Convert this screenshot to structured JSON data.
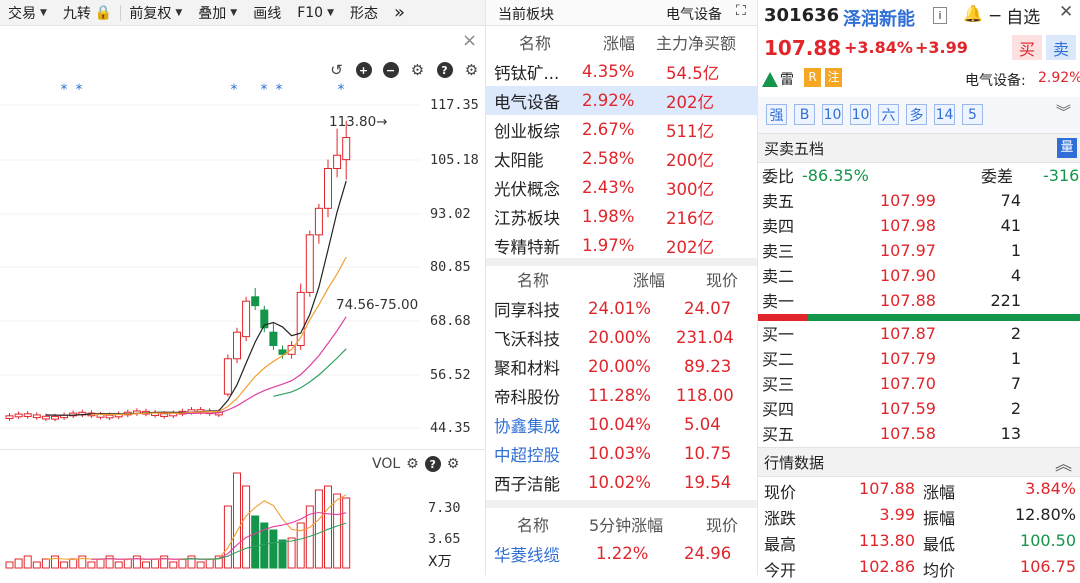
{
  "toolbar": {
    "items": [
      "交易",
      "九转",
      "前复权",
      "叠加",
      "画线",
      "F10",
      "形态"
    ],
    "more": "»",
    "close": "×"
  },
  "chart": {
    "y_labels": [
      "117.35",
      "105.18",
      "93.02",
      "80.85",
      "68.68",
      "56.52",
      "44.35"
    ],
    "high_label": "113.80→",
    "ma_label": "74.56-75.00",
    "vol_label": "VOL",
    "vol_y": [
      "7.30",
      "3.65"
    ],
    "vol_unit": "X万",
    "star": "*"
  },
  "middle": {
    "top": {
      "left": "当前板块",
      "right": "电气设备"
    },
    "sector_headers": [
      "名称",
      "涨幅",
      "主力净买额"
    ],
    "sectors": [
      {
        "name": "钙钛矿...",
        "pct": "4.35%",
        "amt": "54.5亿"
      },
      {
        "name": "电气设备",
        "pct": "2.92%",
        "amt": "202亿"
      },
      {
        "name": "创业板综",
        "pct": "2.67%",
        "amt": "511亿"
      },
      {
        "name": "太阳能",
        "pct": "2.58%",
        "amt": "200亿"
      },
      {
        "name": "光伏概念",
        "pct": "2.43%",
        "amt": "300亿"
      },
      {
        "name": "江苏板块",
        "pct": "1.98%",
        "amt": "216亿"
      },
      {
        "name": "专精特新",
        "pct": "1.97%",
        "amt": "202亿"
      }
    ],
    "stock_headers": [
      "名称",
      "涨幅",
      "现价"
    ],
    "stocks": [
      {
        "name": "同享科技",
        "pct": "24.01%",
        "price": "24.07"
      },
      {
        "name": "飞沃科技",
        "pct": "20.00%",
        "price": "231.04"
      },
      {
        "name": "聚和材料",
        "pct": "20.00%",
        "price": "89.23"
      },
      {
        "name": "帝科股份",
        "pct": "11.28%",
        "price": "118.00"
      },
      {
        "name": "协鑫集成",
        "pct": "10.04%",
        "price": "5.04"
      },
      {
        "name": "中超控股",
        "pct": "10.03%",
        "price": "10.75"
      },
      {
        "name": "西子洁能",
        "pct": "10.02%",
        "price": "19.54"
      }
    ],
    "min5_headers": [
      "名称",
      "5分钟涨幅",
      "现价"
    ],
    "min5": [
      {
        "name": "华菱线缆",
        "pct": "1.22%",
        "price": "24.96"
      }
    ]
  },
  "right": {
    "code": "301636",
    "name": "泽润新能",
    "info_tag": "i",
    "self_select": "自选",
    "price": "107.88",
    "pct": "+3.84%",
    "chg": "+3.99",
    "buy": "买",
    "sell": "卖",
    "lei": "雷",
    "R": "R",
    "zhu": "注",
    "sector_label": "电气设备:",
    "sector_pct": "2.92%",
    "tags": [
      "强",
      "B",
      "10",
      "10",
      "六",
      "多",
      "14",
      "5"
    ],
    "ob_title": "买卖五档",
    "ob_badge": "量",
    "weibi_label": "委比",
    "weibi": "-86.35%",
    "weicha_label": "委差",
    "weicha": "-316",
    "asks": [
      {
        "label": "卖五",
        "price": "107.99",
        "vol": "74"
      },
      {
        "label": "卖四",
        "price": "107.98",
        "vol": "41"
      },
      {
        "label": "卖三",
        "price": "107.97",
        "vol": "1"
      },
      {
        "label": "卖二",
        "price": "107.90",
        "vol": "4"
      },
      {
        "label": "卖一",
        "price": "107.88",
        "vol": "221"
      }
    ],
    "bids": [
      {
        "label": "买一",
        "price": "107.87",
        "vol": "2"
      },
      {
        "label": "买二",
        "price": "107.79",
        "vol": "1"
      },
      {
        "label": "买三",
        "price": "107.70",
        "vol": "7"
      },
      {
        "label": "买四",
        "price": "107.59",
        "vol": "2"
      },
      {
        "label": "买五",
        "price": "107.58",
        "vol": "13"
      }
    ],
    "quote_title": "行情数据",
    "quotes": [
      {
        "l1": "现价",
        "v1": "107.88",
        "l2": "涨幅",
        "v2": "3.84%"
      },
      {
        "l1": "涨跌",
        "v1": "3.99",
        "l2": "振幅",
        "v2": "12.80%"
      },
      {
        "l1": "最高",
        "v1": "113.80",
        "l2": "最低",
        "v2": "100.50"
      },
      {
        "l1": "今开",
        "v1": "102.86",
        "l2": "均价",
        "v2": "106.75"
      }
    ]
  },
  "colors": {
    "up": "#e0252b",
    "down": "#13954a",
    "ma5": "#222222",
    "ma10": "#f0a030",
    "ma20": "#e040a0",
    "ma30": "#30a060"
  }
}
